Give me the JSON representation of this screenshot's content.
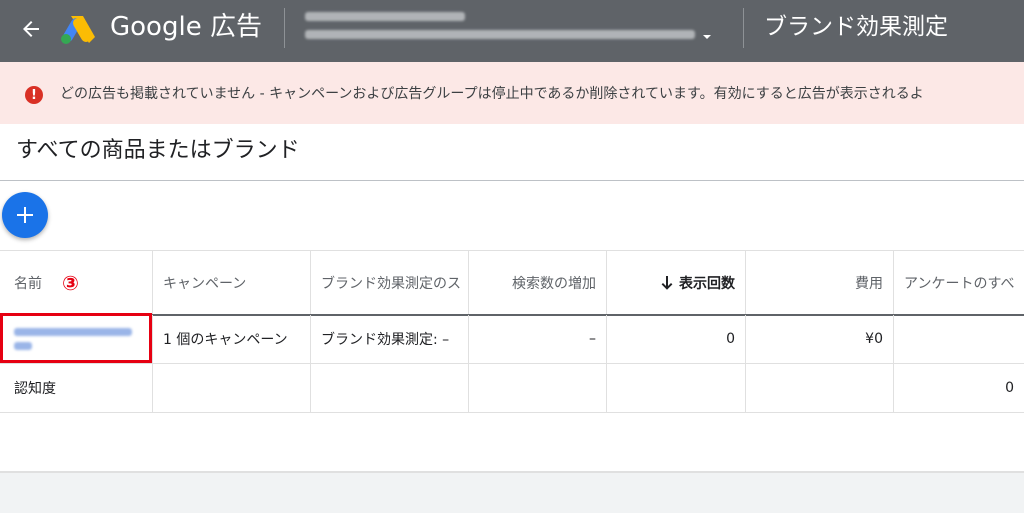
{
  "topbar": {
    "product_name": "Google 広告",
    "account_blurred": true,
    "page_title": "ブランド効果測定"
  },
  "alert": {
    "icon": "error-icon",
    "symbol": "!",
    "message": "どの広告も掲載されていません - キャンペーンおよび広告グループは停止中であるか削除されています。有効にすると広告が表示されるよ"
  },
  "main": {
    "title": "すべての商品またはブランド",
    "add_button_icon": "plus-icon"
  },
  "table": {
    "columns": [
      "名前",
      "キャンペーン",
      "ブランド効果測定のス",
      "検索数の増加",
      "表示回数",
      "費用",
      "アンケートのすべ"
    ],
    "sorted_column": "表示回数",
    "sort_icon": "arrow-down-icon",
    "rows": [
      {
        "name": "",
        "campaign": "1 個のキャンペーン",
        "brand_lift_status": "ブランド効果測定: –",
        "search_lift": "–",
        "impressions": "0",
        "cost": "¥0",
        "survey": ""
      },
      {
        "name": "認知度",
        "campaign": "",
        "brand_lift_status": "",
        "search_lift": "",
        "impressions": "",
        "cost": "",
        "survey": "0"
      }
    ]
  },
  "annotation": {
    "marker": "③",
    "color": "#e60012"
  },
  "colors": {
    "topbar": "#5f6368",
    "alert_bg": "#fce8e6",
    "alert_icon": "#d93025",
    "accent": "#1a73e8"
  }
}
